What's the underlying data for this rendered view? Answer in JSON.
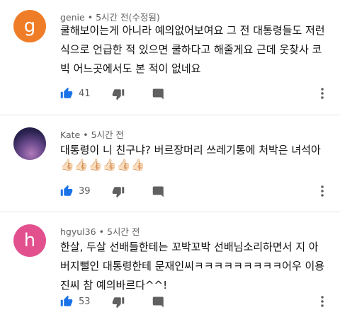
{
  "comments": [
    {
      "author": "genie",
      "avatar_letter": "g",
      "avatar_color": "#ef7d28",
      "time": "5시간 전(수정됨)",
      "text": "쿨해보이는게 아니라 예의없어보여요 그 전 대통령들도 저런\n식으로 언급한 적 있으면 쿨하다고 해줄게요 근데 웃찾사 코\n빅 어느곳에서도 본 적이 없네요",
      "likes": "41",
      "emoji": ""
    },
    {
      "author": "Kate",
      "avatar_letter": "",
      "avatar_color": "#3b2a5c",
      "time": "5시간 전",
      "text": "대통령이 니 친구냐? 버르장머리 쓰레기통에 처박은 녀석아",
      "likes": "39",
      "emoji": "👍🏻👍🏻👍🏻👍🏻👍🏻👍🏻"
    },
    {
      "author": "hgyul36",
      "avatar_letter": "h",
      "avatar_color": "#e2508e",
      "time": "5시간 전",
      "text": "한살, 두살 선배들한테는 꼬박꼬박 선배님소리하면서 지 아\n버지뻘인 대통령한테 문재인씨ㅋㅋㅋㅋㅋㅋㅋㅋㅋ어우 이용\n진씨 참 예의바르다^^!",
      "likes": "53",
      "emoji": ""
    }
  ],
  "icons": {
    "like": "thumbs-up-icon",
    "dislike": "thumbs-down-icon",
    "reply": "reply-icon",
    "more": "more-vertical-icon"
  },
  "colors": {
    "like_blue": "#1a73e8",
    "icon_gray": "#606060"
  }
}
